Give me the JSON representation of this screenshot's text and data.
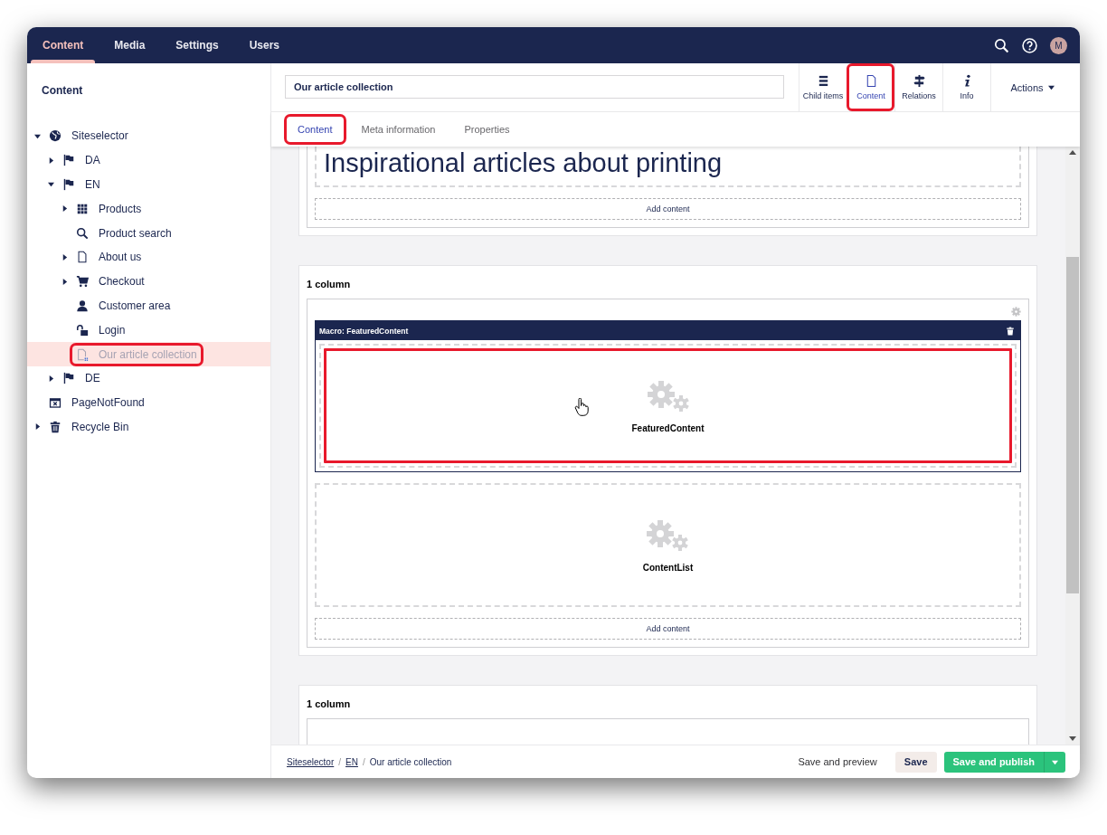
{
  "top_nav": {
    "sections": [
      {
        "label": "Content",
        "selected": true
      },
      {
        "label": "Media",
        "selected": false
      },
      {
        "label": "Settings",
        "selected": false
      },
      {
        "label": "Users",
        "selected": false
      }
    ],
    "avatar_initial": "M"
  },
  "sidebar": {
    "title": "Content",
    "tree": [
      {
        "label": "Siteselector",
        "kind": "globe",
        "has_children": true,
        "expanded": true,
        "selected": false,
        "highlighted": false,
        "children": [
          {
            "label": "DA",
            "kind": "flag",
            "has_children": true,
            "expanded": false,
            "selected": false,
            "highlighted": false
          },
          {
            "label": "EN",
            "kind": "flag",
            "has_children": true,
            "expanded": true,
            "selected": false,
            "highlighted": false,
            "children": [
              {
                "label": "Products",
                "kind": "grid",
                "has_children": true,
                "expanded": false,
                "selected": false,
                "highlighted": false
              },
              {
                "label": "Product search",
                "kind": "search",
                "has_children": false,
                "selected": false,
                "highlighted": false
              },
              {
                "label": "About us",
                "kind": "document",
                "has_children": true,
                "expanded": false,
                "selected": false,
                "highlighted": false
              },
              {
                "label": "Checkout",
                "kind": "cart",
                "has_children": true,
                "expanded": false,
                "selected": false,
                "highlighted": false
              },
              {
                "label": "Customer area",
                "kind": "person",
                "has_children": false,
                "selected": false,
                "highlighted": false
              },
              {
                "label": "Login",
                "kind": "unlock",
                "has_children": false,
                "selected": false,
                "highlighted": false
              },
              {
                "label": "Our article collection",
                "kind": "document-grid",
                "has_children": false,
                "selected": true,
                "highlighted": true
              }
            ]
          },
          {
            "label": "DE",
            "kind": "flag",
            "has_children": true,
            "expanded": false,
            "selected": false,
            "highlighted": false
          }
        ]
      },
      {
        "label": "PageNotFound",
        "kind": "calendar-x",
        "has_children": false,
        "selected": false,
        "highlighted": false
      },
      {
        "label": "Recycle Bin",
        "kind": "trash",
        "has_children": true,
        "expanded": false,
        "selected": false,
        "highlighted": false
      }
    ]
  },
  "editor": {
    "name_value": "Our article collection",
    "apps": [
      {
        "label": "Child items",
        "kind": "list",
        "selected": false,
        "highlighted": false
      },
      {
        "label": "Content",
        "kind": "document",
        "selected": true,
        "highlighted": true
      },
      {
        "label": "Relations",
        "kind": "signpost",
        "selected": false,
        "highlighted": false
      },
      {
        "label": "Info",
        "kind": "info",
        "selected": false,
        "highlighted": false
      }
    ],
    "actions_label": "Actions",
    "tabs": [
      {
        "label": "Content",
        "selected": true,
        "highlighted": true
      },
      {
        "label": "Meta information",
        "selected": false,
        "highlighted": false
      },
      {
        "label": "Properties",
        "selected": false,
        "highlighted": false
      }
    ],
    "sections": [
      {
        "controls": [
          {
            "kind": "heading",
            "text": "Inspirational articles about printing"
          }
        ],
        "add_label": "Add content"
      },
      {
        "label": "1 column",
        "controls": [
          {
            "kind": "macro",
            "header": "Macro: FeaturedContent",
            "name": "FeaturedContent",
            "highlighted": true
          },
          {
            "kind": "macro-preview",
            "name": "ContentList",
            "highlighted": false
          }
        ],
        "add_label": "Add content"
      },
      {
        "label": "1 column",
        "controls": [
          {
            "kind": "empty"
          }
        ]
      }
    ]
  },
  "footer": {
    "separator": "/",
    "breadcrumbs": [
      {
        "label": "Siteselector",
        "kind": "link"
      },
      {
        "label": "EN",
        "kind": "link"
      },
      {
        "label": "Our article collection",
        "kind": "current"
      }
    ],
    "buttons": [
      {
        "label": "Save and preview",
        "kind": "link"
      },
      {
        "label": "Save",
        "kind": "default"
      },
      {
        "label": "Save and publish",
        "kind": "primary"
      }
    ]
  }
}
